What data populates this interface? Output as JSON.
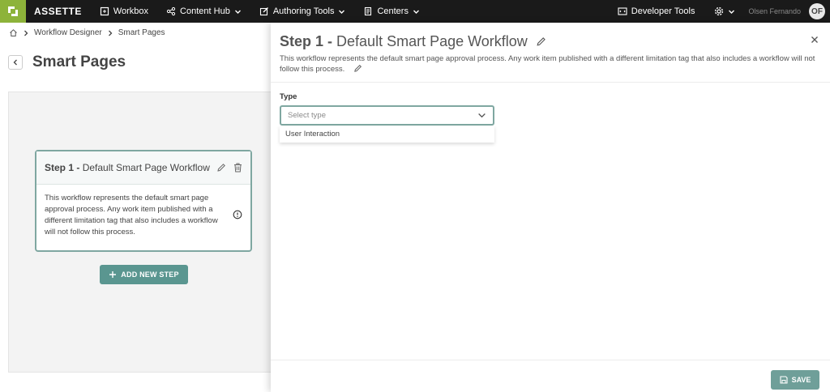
{
  "app": {
    "brand": "ASSETTE"
  },
  "nav": {
    "items": [
      {
        "label": "Workbox",
        "icon": "workbox-icon"
      },
      {
        "label": "Content Hub",
        "icon": "share-icon",
        "dropdown": true
      },
      {
        "label": "Authoring Tools",
        "icon": "edit-square-icon",
        "dropdown": true
      },
      {
        "label": "Centers",
        "icon": "document-icon",
        "dropdown": true
      }
    ],
    "developer_tools": "Developer Tools",
    "user_name": "Olsen Fernando",
    "user_initials": "OF"
  },
  "breadcrumb": {
    "items": [
      "Workflow Designer",
      "Smart Pages"
    ]
  },
  "page": {
    "title": "Smart Pages"
  },
  "step_card": {
    "step_prefix": "Step 1 -",
    "name": "Default Smart Page Workflow",
    "description": "This workflow represents the default smart page approval process. Any work item published with a different limitation tag that also includes a workflow will not follow this process."
  },
  "add_step_label": "ADD NEW STEP",
  "drawer": {
    "title_prefix": "Step 1 -",
    "title_name": "Default Smart Page Workflow",
    "description": "This workflow represents the default smart page approval process. Any work item published with a different limitation tag that also includes a workflow will not follow this process.",
    "type_label": "Type",
    "type_placeholder": "Select type",
    "type_options": [
      "User Interaction"
    ],
    "save_label": "SAVE"
  },
  "colors": {
    "accent": "#5a9690",
    "brand_green": "#8db33a",
    "nav_bg": "#1a1a1a"
  }
}
